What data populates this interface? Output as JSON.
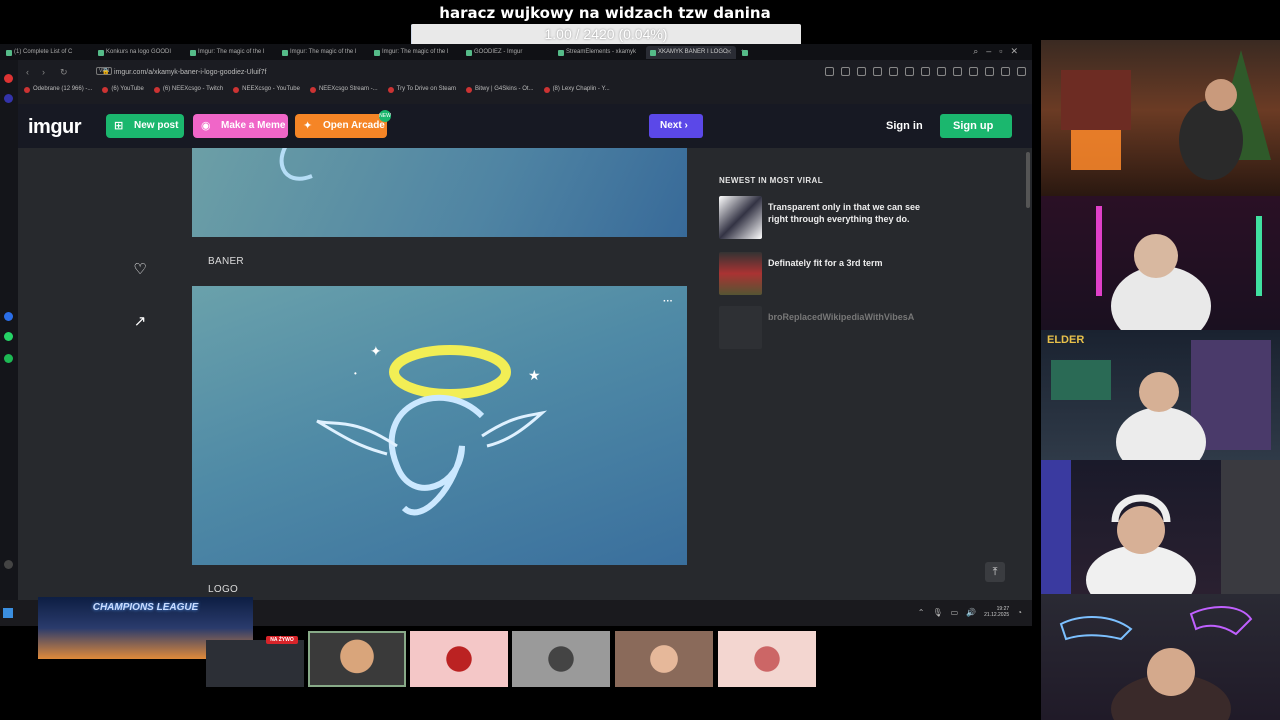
{
  "overlay": {
    "title": "haracz wujkowy na widzach tzw danina",
    "goal_text": "1.00 / 2420 (0.04%)",
    "goal_progress": 0.0004
  },
  "browser": {
    "tabs": [
      {
        "label": "(1) Complete List of C"
      },
      {
        "label": "Konkurs na logo GOODI"
      },
      {
        "label": "Imgur: The magic of the I"
      },
      {
        "label": "Imgur: The magic of the I"
      },
      {
        "label": "Imgur: The magic of the I"
      },
      {
        "label": "GOODIEZ - Imgur"
      },
      {
        "label": "StreamElements - xkamyk"
      },
      {
        "label": "XKAMYK BANER I LOGO"
      }
    ],
    "url": "imgur.com/a/xkamyk-baner-i-logo-goodiez-Uluif7f",
    "vpn_label": "VPN",
    "bookmarks": [
      {
        "label": "Odebrane (12 966) -..."
      },
      {
        "label": "(6) YouTube"
      },
      {
        "label": "(6) NEEXcsgo - Twitch"
      },
      {
        "label": "NEEXcsgo - YouTube"
      },
      {
        "label": "NEEXcsgo Stream -..."
      },
      {
        "label": "Try To Drive on Steam"
      },
      {
        "label": "Bitwy | G4Skins - Ot..."
      },
      {
        "label": "(8) Lexy Chaplin - Y..."
      }
    ]
  },
  "imgur": {
    "logo": "imgur",
    "new_post": "New post",
    "make_meme": "Make a Meme",
    "open_arcade": "Open Arcade",
    "arcade_badge": "NEW",
    "next": "Next",
    "sign_in": "Sign in",
    "sign_up": "Sign up",
    "captions": {
      "banner": "BANER",
      "logo": "LOGO"
    },
    "viral": {
      "heading": "NEWEST IN MOST VIRAL",
      "items": [
        {
          "title": "Transparent only in that we can see right through everything they do."
        },
        {
          "title": "Definately fit for a 3rd term"
        },
        {
          "title": "broReplacedWikipediaWithVibesA"
        }
      ]
    }
  },
  "taskbar": {
    "clock_time": "19:27",
    "clock_date": "21.12.2025",
    "banner_text": "CHAMPIONS LEAGUE",
    "live_badge": "NA ŻYWO"
  },
  "webcam_overlay_tag": "ELDER",
  "colors": {
    "imgur_header": "#171923",
    "content_bg": "#27292d",
    "green": "#1bb76e",
    "pink": "#f066c8",
    "orange": "#f58526",
    "next_purple": "#5b48e8"
  }
}
